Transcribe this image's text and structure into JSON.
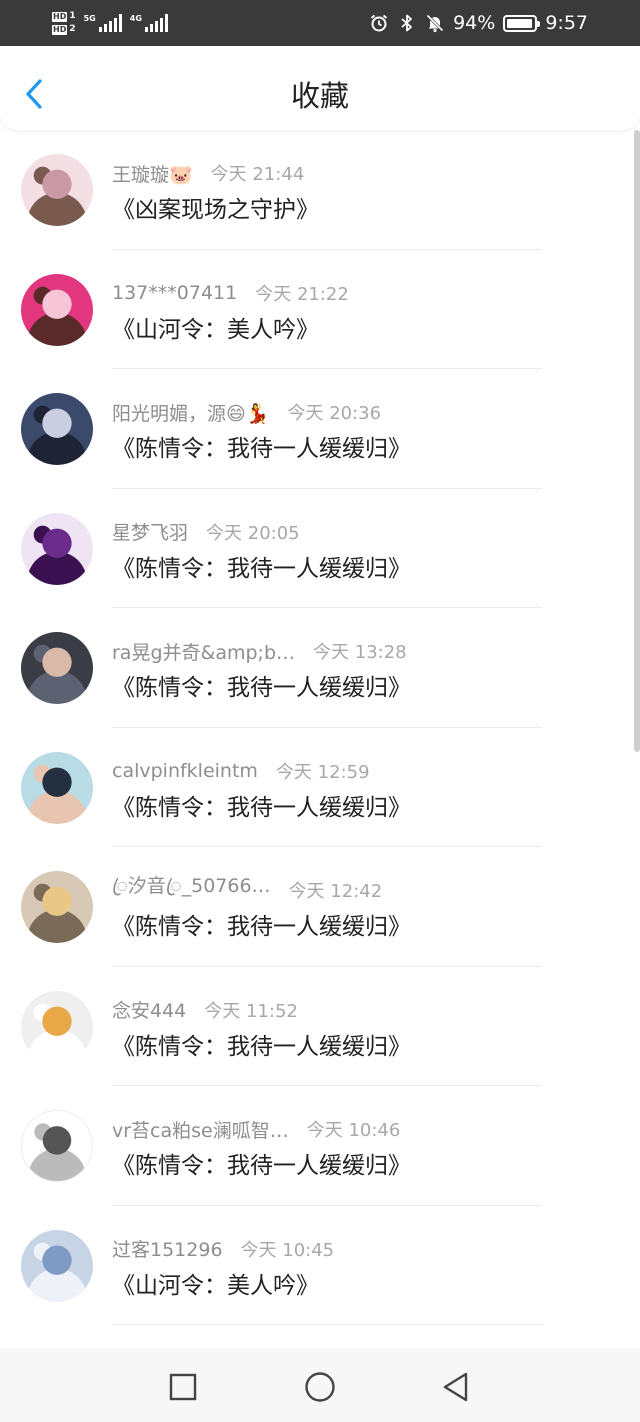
{
  "status_bar": {
    "sim1_label": "HD",
    "sim1_num": "1",
    "sim2_label": "HD",
    "sim2_num": "2",
    "net1": "5G",
    "net2": "4G",
    "battery_percent": "94%",
    "battery_level": 0.94,
    "time": "9:57",
    "icons": [
      "alarm-icon",
      "bluetooth-icon",
      "mute-icon",
      "battery-icon"
    ]
  },
  "header": {
    "title": "收藏",
    "back_icon": "chevron-left-icon",
    "accent": "#2196f3"
  },
  "items": [
    {
      "name": "王璇璇🐷",
      "time": "今天 21:44",
      "work": "《凶案现场之守护》",
      "avatar": {
        "bg": "#f4dfe4",
        "fg": "#c99aa6",
        "fg2": "#7a5a4e"
      }
    },
    {
      "name": "137***07411",
      "time": "今天 21:22",
      "work": "《山河令：美人吟》",
      "avatar": {
        "bg": "#e2367e",
        "fg": "#f6c6d6",
        "fg2": "#5a2a2a"
      }
    },
    {
      "name": "阳光明媚，源😄💃",
      "time": "今天 20:36",
      "work": "《陈情令：我待一人缓缓归》",
      "avatar": {
        "bg": "#3b4a6a",
        "fg": "#c9cfe0",
        "fg2": "#1e2336"
      }
    },
    {
      "name": "星梦飞羽",
      "time": "今天 20:05",
      "work": "《陈情令：我待一人缓缓归》",
      "avatar": {
        "bg": "#efe4f4",
        "fg": "#6a2b8a",
        "fg2": "#3a1050"
      }
    },
    {
      "name": "ra晃g并奇&amp;b…",
      "time": "今天 13:28",
      "work": "《陈情令：我待一人缓缓归》",
      "avatar": {
        "bg": "#3a3d45",
        "fg": "#d9b9a8",
        "fg2": "#5d6272"
      }
    },
    {
      "name": "calvpinfkleintm",
      "time": "今天 12:59",
      "work": "《陈情令：我待一人缓缓归》",
      "avatar": {
        "bg": "#b9dbe6",
        "fg": "#243040",
        "fg2": "#e8c5b0"
      }
    },
    {
      "name": "ꦿ汐音ꦿ_50766…",
      "time": "今天 12:42",
      "work": "《陈情令：我待一人缓缓归》",
      "avatar": {
        "bg": "#d8c9b6",
        "fg": "#e9c887",
        "fg2": "#7a6a58"
      }
    },
    {
      "name": "念安444",
      "time": "今天 11:52",
      "work": "《陈情令：我待一人缓缓归》",
      "avatar": {
        "bg": "#efefef",
        "fg": "#e9a847",
        "fg2": "#ffffff"
      }
    },
    {
      "name": "vr苔ca粕se澜呱智…",
      "time": "今天 10:46",
      "work": "《陈情令：我待一人缓缓归》",
      "avatar": {
        "bg": "#ffffff",
        "fg": "#555555",
        "fg2": "#bbbbbb"
      }
    },
    {
      "name": "过客151296",
      "time": "今天 10:45",
      "work": "《山河令：美人吟》",
      "avatar": {
        "bg": "#c7d4e6",
        "fg": "#7f9bc4",
        "fg2": "#eef2f8"
      }
    }
  ],
  "nav": {
    "recent_icon": "square-icon",
    "home_icon": "circle-icon",
    "back_icon": "triangle-back-icon"
  }
}
